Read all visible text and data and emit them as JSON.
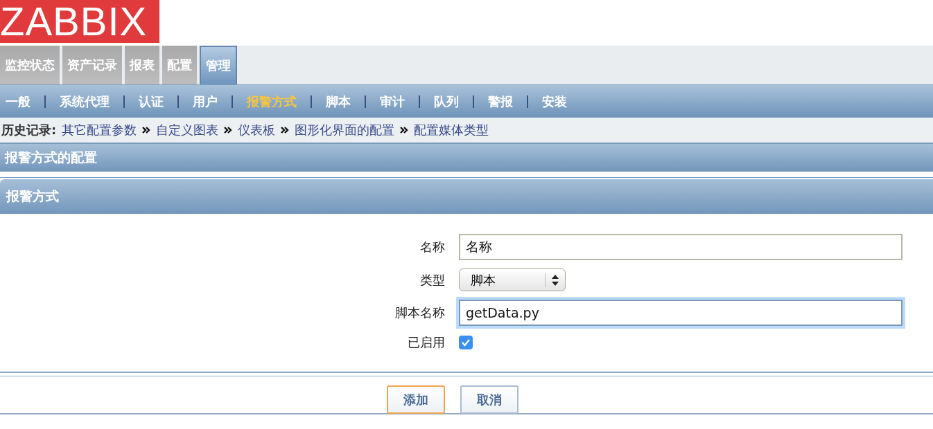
{
  "logo": {
    "text": "ZABBIX"
  },
  "main_menu": [
    {
      "label": "监控状态",
      "selected": false
    },
    {
      "label": "资产记录",
      "selected": false
    },
    {
      "label": "报表",
      "selected": false
    },
    {
      "label": "配置",
      "selected": false
    },
    {
      "label": "管理",
      "selected": true
    }
  ],
  "sub_menu": [
    {
      "label": "一般",
      "selected": false
    },
    {
      "label": "系统代理",
      "selected": false
    },
    {
      "label": "认证",
      "selected": false
    },
    {
      "label": "用户",
      "selected": false
    },
    {
      "label": "报警方式",
      "selected": true
    },
    {
      "label": "脚本",
      "selected": false
    },
    {
      "label": "审计",
      "selected": false
    },
    {
      "label": "队列",
      "selected": false
    },
    {
      "label": "警报",
      "selected": false
    },
    {
      "label": "安装",
      "selected": false
    }
  ],
  "history": {
    "label": "历史记录:",
    "items": [
      "其它配置参数",
      "自定义图表",
      "仪表板",
      "图形化界面的配置",
      "配置媒体类型"
    ]
  },
  "page_title": "报警方式的配置",
  "section_title": "报警方式",
  "form": {
    "fields": [
      {
        "kind": "text",
        "label": "名称",
        "value": "名称",
        "focused": false
      },
      {
        "kind": "select",
        "label": "类型",
        "value": "脚本"
      },
      {
        "kind": "text",
        "label": "脚本名称",
        "value": "getData.py",
        "focused": true
      },
      {
        "kind": "checkbox",
        "label": "已启用",
        "checked": true
      }
    ]
  },
  "buttons": [
    {
      "label": "添加",
      "default": true
    },
    {
      "label": "取消",
      "default": false
    }
  ]
}
